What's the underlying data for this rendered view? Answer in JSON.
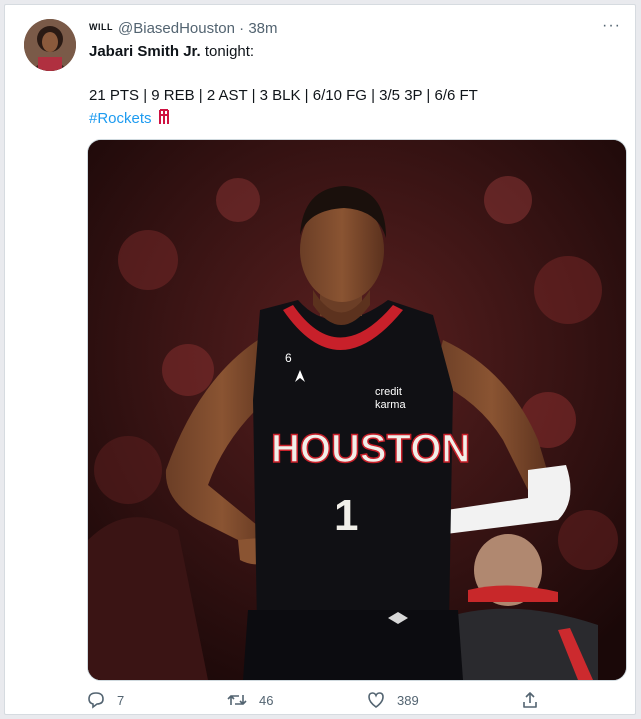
{
  "tweet": {
    "display_name": "WILL",
    "handle": "@BiasedHouston",
    "separator": "·",
    "time": "38m",
    "more_label": "···",
    "player_name": "Jabari Smith Jr.",
    "title_rest": " tonight:",
    "stat_line": "21 PTS | 9 REB | 2 AST | 3 BLK | 6/10 FG | 3/5 3P | 6/6 FT",
    "hashtag": "#Rockets",
    "hashtag_icon": "rockets-logo-icon"
  },
  "media": {
    "jersey_text": "HOUSTON",
    "jersey_number": "1",
    "patch_number": "6",
    "sponsor_line1": "credit",
    "sponsor_line2": "karma"
  },
  "actions": {
    "reply_count": "7",
    "retweet_count": "46",
    "like_count": "389"
  },
  "colors": {
    "link": "#1d9bf0",
    "rockets_red": "#ce1141",
    "muted": "#536471"
  }
}
